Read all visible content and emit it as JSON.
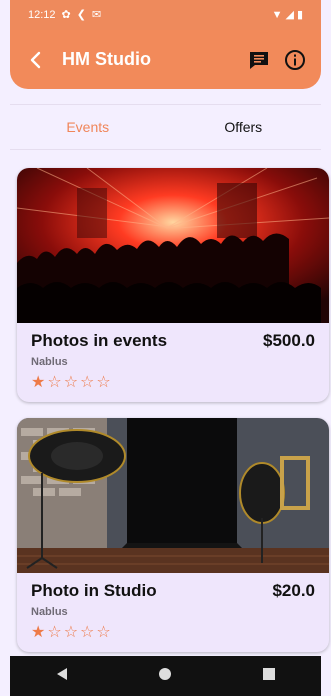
{
  "status_bar": {
    "time": "12:12"
  },
  "app_bar": {
    "title": "HM Studio"
  },
  "tabs": [
    {
      "label": "Events"
    },
    {
      "label": "Offers"
    }
  ],
  "cards": [
    {
      "title": "Photos in events",
      "price": "$500.0",
      "location": "Nablus",
      "rating": 1,
      "stars_filled": "★",
      "stars_empty": "☆☆☆☆"
    },
    {
      "title": "Photo in Studio",
      "price": "$20.0",
      "location": "Nablus",
      "rating": 1,
      "stars_filled": "★",
      "stars_empty": "☆☆☆☆"
    }
  ],
  "colors": {
    "accent": "#f28a5a",
    "background": "#f4efff",
    "card": "#efe6fc",
    "star": "#ee7a48"
  }
}
